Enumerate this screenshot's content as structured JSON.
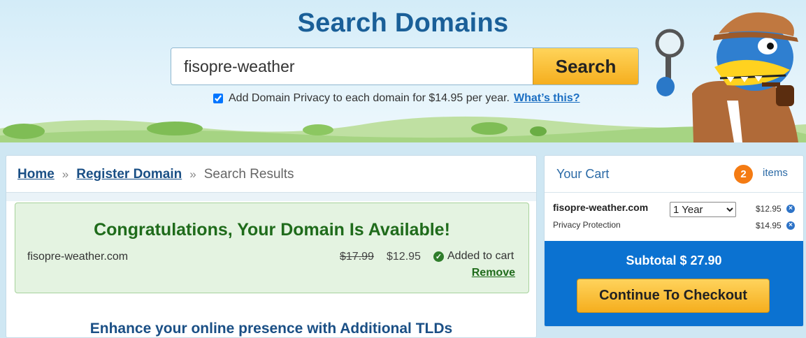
{
  "hero": {
    "title": "Search Domains",
    "search_value": "fisopre-weather",
    "search_button": "Search",
    "privacy_text": "Add Domain Privacy to each domain for $14.95 per year.",
    "privacy_link": "What’s this?",
    "privacy_checked": true
  },
  "breadcrumb": {
    "home": "Home",
    "sep": "»",
    "register": "Register Domain",
    "current": "Search Results"
  },
  "result": {
    "title": "Congratulations, Your Domain Is Available!",
    "domain": "fisopre-weather.com",
    "old_price": "$17.99",
    "new_price": "$12.95",
    "status": "Added to cart",
    "remove": "Remove"
  },
  "enhance_text": "Enhance your online presence with Additional TLDs",
  "cart": {
    "title": "Your Cart",
    "count": "2",
    "items_label": "items",
    "domain": "fisopre-weather.com",
    "term": "1 Year",
    "domain_price": "$12.95",
    "privacy_label": "Privacy Protection",
    "privacy_price": "$14.95",
    "subtotal": "Subtotal $ 27.90",
    "checkout": "Continue To Checkout"
  },
  "colors": {
    "brand_blue": "#1a5f98",
    "accent_orange": "#f5ae1e",
    "success_green": "#1f6b1b",
    "cart_blue": "#0b72d1"
  }
}
